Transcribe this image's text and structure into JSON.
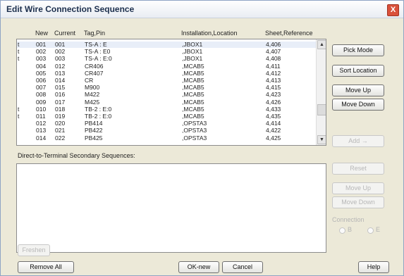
{
  "window": {
    "title": "Edit Wire Connection Sequence",
    "close_glyph": "X"
  },
  "table": {
    "headers": {
      "new": "New",
      "current": "Current",
      "tag_pin": "Tag,Pin",
      "location": "Installation,Location",
      "sheet": "Sheet,Reference"
    },
    "rows": [
      {
        "flag": "t",
        "new": "001",
        "current": "001",
        "tag": "TS-A : E",
        "location": ",JBOX1",
        "sheet": "4,406"
      },
      {
        "flag": "t",
        "new": "002",
        "current": "002",
        "tag": "TS-A : E0",
        "location": ",JBOX1",
        "sheet": "4,407"
      },
      {
        "flag": "t",
        "new": "003",
        "current": "003",
        "tag": "TS-A : E:0",
        "location": ",JBOX1",
        "sheet": "4,408"
      },
      {
        "flag": "",
        "new": "004",
        "current": "012",
        "tag": "CR406",
        "location": ",MCAB5",
        "sheet": "4,411"
      },
      {
        "flag": "",
        "new": "005",
        "current": "013",
        "tag": "CR407",
        "location": ",MCAB5",
        "sheet": "4,412"
      },
      {
        "flag": "",
        "new": "006",
        "current": "014",
        "tag": "CR",
        "location": ",MCAB5",
        "sheet": "4,413"
      },
      {
        "flag": "",
        "new": "007",
        "current": "015",
        "tag": "M900",
        "location": ",MCAB5",
        "sheet": "4,415"
      },
      {
        "flag": "",
        "new": "008",
        "current": "016",
        "tag": "M422",
        "location": ",MCAB5",
        "sheet": "4,423"
      },
      {
        "flag": "",
        "new": "009",
        "current": "017",
        "tag": "M425",
        "location": ",MCAB5",
        "sheet": "4,426"
      },
      {
        "flag": "t",
        "new": "010",
        "current": "018",
        "tag": "TB-2 : E:0",
        "location": ",MCAB5",
        "sheet": "4,433"
      },
      {
        "flag": "t",
        "new": "011",
        "current": "019",
        "tag": "TB-2 : E:0",
        "location": ",MCAB5",
        "sheet": "4,435"
      },
      {
        "flag": "",
        "new": "012",
        "current": "020",
        "tag": "PB414",
        "location": ",OPSTA3",
        "sheet": "4,414"
      },
      {
        "flag": "",
        "new": "013",
        "current": "021",
        "tag": "PB422",
        "location": ",OPSTA3",
        "sheet": "4,422"
      },
      {
        "flag": "",
        "new": "014",
        "current": "022",
        "tag": "PB425",
        "location": ",OPSTA3",
        "sheet": "4,425"
      }
    ]
  },
  "buttons": {
    "pick_mode": "Pick Mode",
    "sort_location": "Sort Location",
    "move_up": "Move Up",
    "move_down": "Move Down",
    "add": "Add →",
    "reset": "Reset",
    "move_up2": "Move Up",
    "move_down2": "Move Down",
    "freshen": "Freshen",
    "remove_all": "Remove All",
    "ok_new": "OK-new",
    "cancel": "Cancel",
    "help": "Help"
  },
  "secondary_label": "Direct-to-Terminal Secondary Sequences:",
  "connection": {
    "label": "Connection",
    "opt1": "B",
    "opt2": "E"
  },
  "scroll": {
    "up": "▲",
    "down": "▼"
  }
}
